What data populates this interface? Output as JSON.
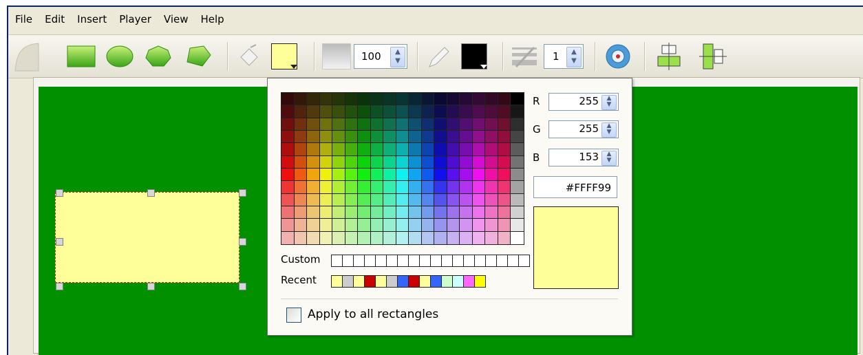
{
  "menu": [
    "File",
    "Edit",
    "Insert",
    "Player",
    "View",
    "Help"
  ],
  "toolbar": {
    "opacity_value": "100",
    "line_width_value": "1",
    "fill_color": "#ffff99",
    "line_color": "#000000"
  },
  "color_picker": {
    "r_label": "R",
    "g_label": "G",
    "b_label": "B",
    "r_value": "255",
    "g_value": "255",
    "b_value": "153",
    "hex_value": "#FFFF99",
    "custom_label": "Custom",
    "recent_label": "Recent",
    "custom_colors": [
      "#ffffff",
      "#ffffff",
      "#ffffff",
      "#ffffff",
      "#ffffff",
      "#ffffff",
      "#ffffff",
      "#ffffff",
      "#ffffff",
      "#ffffff",
      "#ffffff",
      "#ffffff",
      "#ffffff",
      "#ffffff",
      "#ffffff",
      "#ffffff",
      "#ffffff",
      "#ffffff"
    ],
    "recent_colors": [
      "#ffff99",
      "#cccccc",
      "#ffff99",
      "#cc0000",
      "#ffff99",
      "#cccccc",
      "#3366ff",
      "#cc0000",
      "#ffff99",
      "#3366ff",
      "#ccffcc",
      "#ccffff",
      "#ff66ff",
      "#ffff00"
    ],
    "apply_all_label": "Apply to all rectangles",
    "apply_all_checked": false
  },
  "colors": {
    "canvas_bg": "#009000",
    "shape_fill": "#ffff99",
    "shape_border": "#c03030"
  }
}
